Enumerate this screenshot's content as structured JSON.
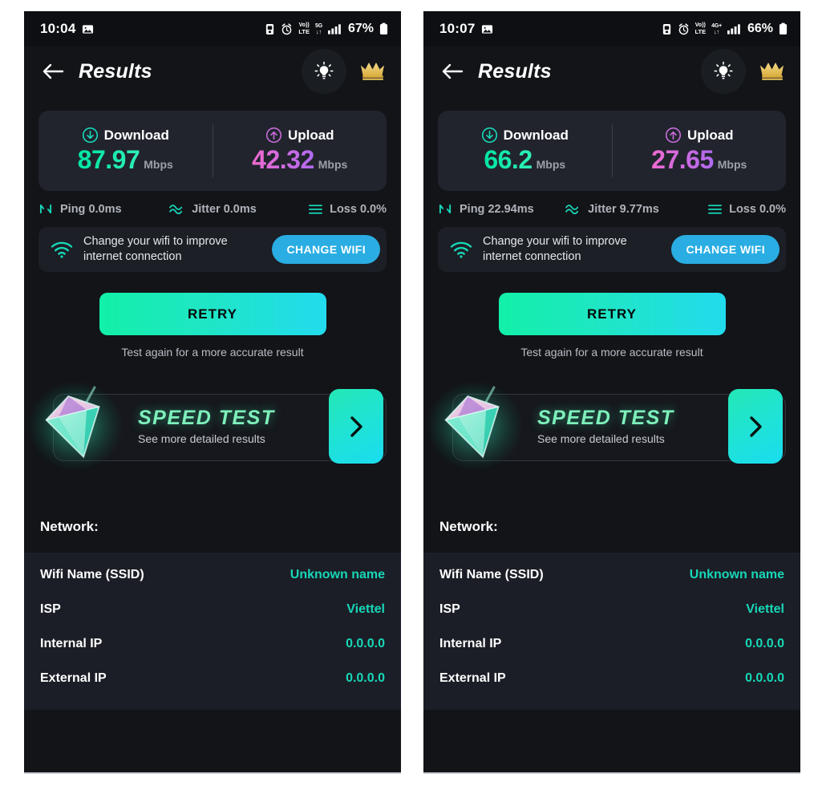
{
  "panels": [
    {
      "status_bar": {
        "time": "10:04",
        "photo_icon": "photo-icon",
        "icons": [
          "sim-icon",
          "alarm-icon",
          "volte-icon"
        ],
        "volte_top": "VoLTE",
        "volte_sup": "Vo))",
        "volte_sub": "LTE",
        "network_type": "5G",
        "network_arrows": "↓↑",
        "signal_icon": "signal-bars-icon",
        "battery_text": "67%",
        "battery_icon": "battery-icon"
      },
      "header": {
        "back_icon": "back-arrow-icon",
        "title": "Results",
        "bulb_icon": "lightbulb-icon",
        "crown_icon": "crown-icon"
      },
      "speed": {
        "download_label": "Download",
        "download_value": "87.97",
        "download_unit": "Mbps",
        "download_icon": "download-arrow-icon",
        "upload_label": "Upload",
        "upload_value": "42.32",
        "upload_unit": "Mbps",
        "upload_icon": "upload-arrow-icon"
      },
      "metrics": {
        "ping": "Ping 0.0ms",
        "jitter": "Jitter 0.0ms",
        "loss": "Loss 0.0%"
      },
      "wifi_banner": {
        "icon": "wifi-icon",
        "line1": "Change your wifi to improve",
        "line2": "internet connection",
        "button": "CHANGE WIFI"
      },
      "retry": {
        "label": "RETRY",
        "subtitle": "Test again for a more accurate result"
      },
      "promo": {
        "gem_icon": "diamond-gem-icon",
        "title": "SPEED TEST",
        "subtitle": "See more detailed results",
        "arrow_icon": "chevron-right-icon"
      },
      "network": {
        "title": "Network:",
        "rows": [
          {
            "key": "Wifi Name (SSID)",
            "value": "Unknown name"
          },
          {
            "key": "ISP",
            "value": "Viettel"
          },
          {
            "key": "Internal IP",
            "value": "0.0.0.0"
          },
          {
            "key": "External IP",
            "value": "0.0.0.0"
          }
        ]
      }
    },
    {
      "status_bar": {
        "time": "10:07",
        "photo_icon": "photo-icon",
        "icons": [
          "sim-icon",
          "alarm-icon",
          "volte-icon"
        ],
        "volte_top": "VoLTE",
        "volte_sup": "Vo))",
        "volte_sub": "LTE",
        "network_type": "4G+",
        "network_arrows": "↓↑",
        "signal_icon": "signal-bars-icon",
        "battery_text": "66%",
        "battery_icon": "battery-icon"
      },
      "header": {
        "back_icon": "back-arrow-icon",
        "title": "Results",
        "bulb_icon": "lightbulb-icon",
        "crown_icon": "crown-icon"
      },
      "speed": {
        "download_label": "Download",
        "download_value": "66.2",
        "download_unit": "Mbps",
        "download_icon": "download-arrow-icon",
        "upload_label": "Upload",
        "upload_value": "27.65",
        "upload_unit": "Mbps",
        "upload_icon": "upload-arrow-icon"
      },
      "metrics": {
        "ping": "Ping 22.94ms",
        "jitter": "Jitter 9.77ms",
        "loss": "Loss 0.0%"
      },
      "wifi_banner": {
        "icon": "wifi-icon",
        "line1": "Change your wifi to improve",
        "line2": "internet connection",
        "button": "CHANGE WIFI"
      },
      "retry": {
        "label": "RETRY",
        "subtitle": "Test again for a more accurate result"
      },
      "promo": {
        "gem_icon": "diamond-gem-icon",
        "title": "SPEED TEST",
        "subtitle": "See more detailed results",
        "arrow_icon": "chevron-right-icon"
      },
      "network": {
        "title": "Network:",
        "rows": [
          {
            "key": "Wifi Name (SSID)",
            "value": "Unknown name"
          },
          {
            "key": "ISP",
            "value": "Viettel"
          },
          {
            "key": "Internal IP",
            "value": "0.0.0.0"
          },
          {
            "key": "External IP",
            "value": "0.0.0.0"
          }
        ]
      }
    }
  ],
  "colors": {
    "page_bg": "#121418",
    "card_bg": "#21242d",
    "download_accent": "#00e6a0",
    "upload_accent": "#e06ad8",
    "teal": "#17d7b8",
    "blue_button": "#29ade3",
    "crown_gold": "#e8c25a",
    "promo_green": "#7ef0bb"
  }
}
